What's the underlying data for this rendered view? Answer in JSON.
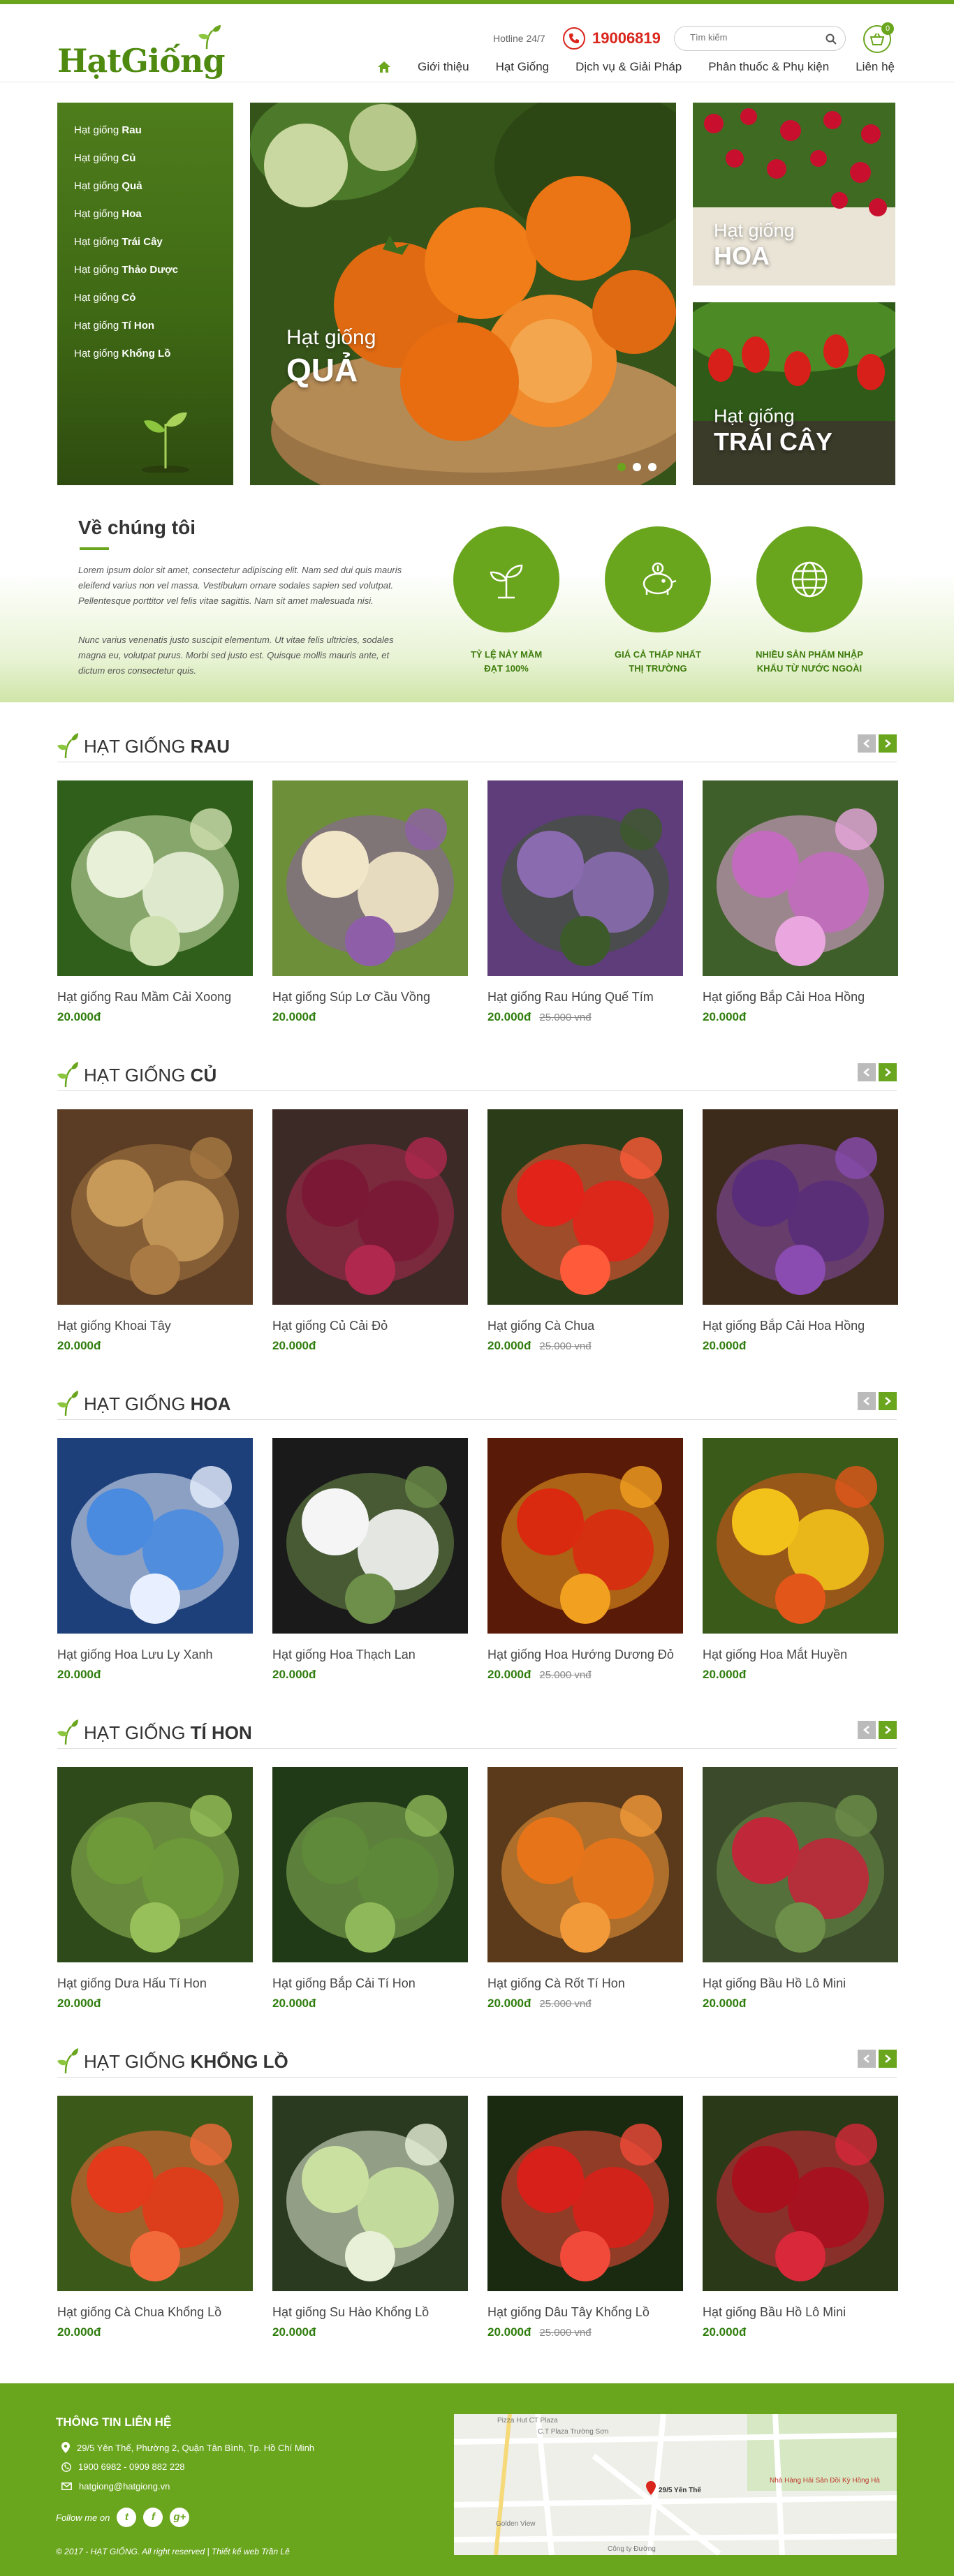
{
  "header": {
    "logo": "HạtGiống",
    "hotline_label": "Hotline 24/7",
    "phone": "19006819",
    "search_placeholder": "Tìm kiếm",
    "cart_count": "0",
    "nav": [
      "Giới thiệu",
      "Hạt Giống",
      "Dịch vụ & Giải Pháp",
      "Phân thuốc & Phụ kiện",
      "Liên hệ"
    ]
  },
  "sidebar": {
    "items": [
      {
        "prefix": "Hạt giống",
        "name": "Rau"
      },
      {
        "prefix": "Hạt giống",
        "name": "Củ"
      },
      {
        "prefix": "Hạt giống",
        "name": "Quả"
      },
      {
        "prefix": "Hạt giống",
        "name": "Hoa"
      },
      {
        "prefix": "Hạt giống",
        "name": "Trái Cây"
      },
      {
        "prefix": "Hạt giống",
        "name": "Thảo Dược"
      },
      {
        "prefix": "Hạt giống",
        "name": "Cỏ"
      },
      {
        "prefix": "Hạt giống",
        "name": "Tí Hon"
      },
      {
        "prefix": "Hạt giống",
        "name": "Khổng Lồ"
      }
    ]
  },
  "slider": {
    "line1": "Hạt giống",
    "line2": "QUẢ"
  },
  "tiles": [
    {
      "line1": "Hạt giống",
      "line2": "HOA"
    },
    {
      "line1": "Hạt giống",
      "line2": "TRÁI CÂY"
    }
  ],
  "about": {
    "title": "Về chúng tôi",
    "p1": "Lorem ipsum dolor sit amet, consectetur adipiscing elit. Nam sed dui quis mauris eleifend varius non vel massa. Vestibulum ornare sodales sapien sed volutpat. Pellentesque porttitor vel felis vitae sagittis. Nam sit amet malesuada nisi.",
    "p2": "Nunc varius venenatis justo suscipit elementum. Ut vitae felis ultricies, sodales magna eu, volutpat purus. Morbi sed justo est. Quisque mollis mauris ante, et dictum eros consectetur quis.",
    "features": [
      {
        "l1": "TỶ LỆ NẢY MẦM",
        "l2": "ĐẠT 100%",
        "icon": "sprout-icon"
      },
      {
        "l1": "GIÁ CẢ THẤP NHẤT",
        "l2": "THỊ TRƯỜNG",
        "icon": "piggy-bank-icon"
      },
      {
        "l1": "NHIỀU SẢN PHẨM NHẬP",
        "l2": "KHẨU TỪ NƯỚC NGOÀI",
        "icon": "globe-icon"
      }
    ]
  },
  "sections": [
    {
      "prefix": "HẠT GIỐNG",
      "name": "RAU",
      "products": [
        {
          "name": "Hạt giống Rau Mầm Cải Xoong",
          "price": "20.000đ",
          "old": ""
        },
        {
          "name": "Hạt giống Súp Lơ Cầu Vồng",
          "price": "20.000đ",
          "old": ""
        },
        {
          "name": "Hạt giống Rau Húng Quế Tím",
          "price": "20.000đ",
          "old": "25.000 vnđ"
        },
        {
          "name": "Hạt giống Bắp Cải Hoa Hồng",
          "price": "20.000đ",
          "old": ""
        }
      ]
    },
    {
      "prefix": "HẠT GIỐNG",
      "name": "CỦ",
      "products": [
        {
          "name": "Hạt giống Khoai Tây",
          "price": "20.000đ",
          "old": ""
        },
        {
          "name": "Hạt giống Củ Cải Đỏ",
          "price": "20.000đ",
          "old": ""
        },
        {
          "name": "Hạt giống Cà Chua",
          "price": "20.000đ",
          "old": "25.000 vnđ"
        },
        {
          "name": "Hạt giống Bắp Cải Hoa Hồng",
          "price": "20.000đ",
          "old": ""
        }
      ]
    },
    {
      "prefix": "HẠT GIỐNG",
      "name": "HOA",
      "products": [
        {
          "name": "Hạt giống Hoa Lưu Ly Xanh",
          "price": "20.000đ",
          "old": ""
        },
        {
          "name": "Hạt giống Hoa Thạch Lan",
          "price": "20.000đ",
          "old": ""
        },
        {
          "name": "Hạt giống Hoa Hướng Dương Đỏ",
          "price": "20.000đ",
          "old": "25.000 vnđ"
        },
        {
          "name": "Hạt giống Hoa Mắt Huyền",
          "price": "20.000đ",
          "old": ""
        }
      ]
    },
    {
      "prefix": "HẠT GIỐNG",
      "name": "TÍ HON",
      "products": [
        {
          "name": "Hạt giống Dưa Hấu Tí Hon",
          "price": "20.000đ",
          "old": ""
        },
        {
          "name": "Hạt giống Bắp Cải Tí Hon",
          "price": "20.000đ",
          "old": ""
        },
        {
          "name": "Hạt giống Cà Rốt Tí Hon",
          "price": "20.000đ",
          "old": "25.000 vnđ"
        },
        {
          "name": "Hạt giống Bầu Hồ Lô Mini",
          "price": "20.000đ",
          "old": ""
        }
      ]
    },
    {
      "prefix": "HẠT GIỐNG",
      "name": "KHỔNG LỒ",
      "products": [
        {
          "name": "Hạt giống Cà Chua Khổng Lồ",
          "price": "20.000đ",
          "old": ""
        },
        {
          "name": "Hạt giống Su Hào Khổng Lồ",
          "price": "20.000đ",
          "old": ""
        },
        {
          "name": "Hạt giống Dâu Tây Khổng Lồ",
          "price": "20.000đ",
          "old": "25.000 vnđ"
        },
        {
          "name": "Hạt giống Bầu Hồ Lô Mini",
          "price": "20.000đ",
          "old": ""
        }
      ]
    }
  ],
  "footer": {
    "title": "THÔNG TIN LIÊN HỆ",
    "address": "29/5 Yên Thế, Phường 2, Quận Tân Bình, Tp. Hồ Chí Minh",
    "phones": "1900 6982 - 0909 882 228",
    "email": "hatgiong@hatgiong.vn",
    "follow": "Follow me on",
    "copyright": "© 2017 - HẠT GIỐNG. All right reserved  |  Thiết kế web Trần Lê",
    "map_labels": [
      "Pizza Hut CT Plaza",
      "C.T Plaza Trường Sơn",
      "29/5 Yên Thế",
      "Nhà Hàng Hải Sản Đồi Kỳ Hồng Hà",
      "Golden View",
      "Công ty Đường"
    ]
  },
  "colors": {
    "brand": "#6aa51e",
    "brand_dark": "#2f7d0d",
    "hotline": "#d9251c"
  }
}
